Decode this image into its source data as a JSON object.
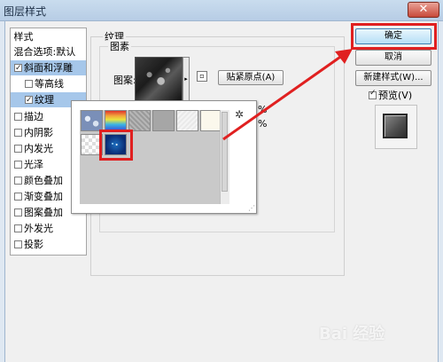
{
  "window": {
    "title": "图层样式",
    "close": "✕"
  },
  "styles_list": {
    "header": "样式",
    "blend_options": "混合选项:默认",
    "items": [
      {
        "label": "斜面和浮雕",
        "checked": true,
        "selected": true
      },
      {
        "label": "等高线",
        "checked": false,
        "selected": false
      },
      {
        "label": "纹理",
        "checked": true,
        "selected": true
      },
      {
        "label": "描边",
        "checked": false
      },
      {
        "label": "内阴影",
        "checked": false
      },
      {
        "label": "内发光",
        "checked": false
      },
      {
        "label": "光泽",
        "checked": false
      },
      {
        "label": "颜色叠加",
        "checked": false
      },
      {
        "label": "渐变叠加",
        "checked": false
      },
      {
        "label": "图案叠加",
        "checked": false
      },
      {
        "label": "外发光",
        "checked": false
      },
      {
        "label": "投影",
        "checked": false
      }
    ]
  },
  "texture": {
    "group_title": "纹理",
    "element_title": "图素",
    "pattern_label": "图案:",
    "snap_origin_button": "贴紧原点(A)",
    "percent1": "%",
    "percent2": "%"
  },
  "buttons": {
    "ok": "确定",
    "cancel": "取消",
    "new_style": "新建样式(W)...",
    "preview": "预览(V)"
  },
  "icons": {
    "close": "close-icon",
    "gear": "gear-icon",
    "dropdown": "chevron-right-icon",
    "new_preset": "new-preset-icon"
  },
  "watermark": "Bai 经验",
  "colors": {
    "highlight": "#e02020",
    "selected_row": "#a6c7ea"
  }
}
